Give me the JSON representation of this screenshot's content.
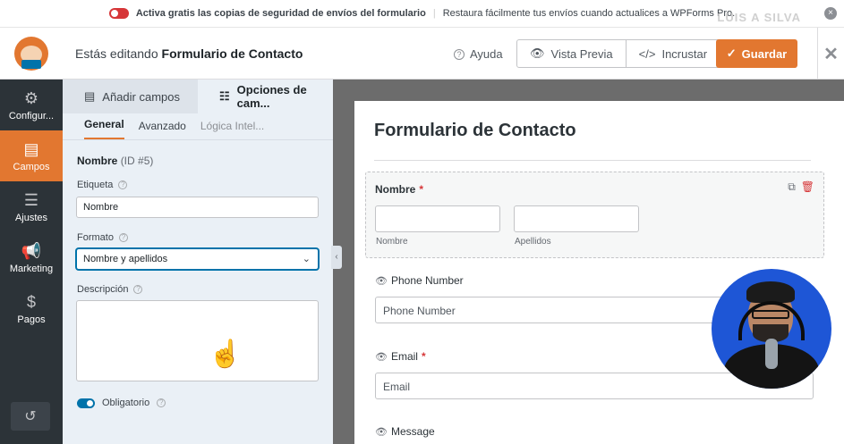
{
  "notice": {
    "strong_text": "Activa gratis las copias de seguridad de envíos del formulario",
    "text": "Restaura fácilmente tus envíos cuando actualices a WPForms Pro.",
    "close": "×",
    "watermark": "LUIS A SILVA"
  },
  "header": {
    "editing_prefix": "Estás editando",
    "form_name": "Formulario de Contacto",
    "help": "Ayuda",
    "preview": "Vista Previa",
    "embed": "Incrustar",
    "save": "Guardar",
    "close": "✕"
  },
  "nav": {
    "items": [
      {
        "label": "Configur...",
        "icon": "gear-icon",
        "glyph": "⚙"
      },
      {
        "label": "Campos",
        "icon": "fields-icon",
        "glyph": "▤"
      },
      {
        "label": "Ajustes",
        "icon": "sliders-icon",
        "glyph": "☰"
      },
      {
        "label": "Marketing",
        "icon": "megaphone-icon",
        "glyph": "📢"
      },
      {
        "label": "Pagos",
        "icon": "dollar-icon",
        "glyph": "$"
      }
    ],
    "history_glyph": "↺"
  },
  "panel": {
    "tabs": [
      "Añadir campos",
      "Opciones de cam..."
    ],
    "subtabs": [
      "General",
      "Avanzado",
      "Lógica Intel..."
    ],
    "field_name": "Nombre",
    "field_id": "(ID #5)",
    "label_label": "Etiqueta",
    "label_value": "Nombre",
    "format_label": "Formato",
    "format_value": "Nombre y apellidos",
    "description_label": "Descripción",
    "required_label": "Obligatorio"
  },
  "form": {
    "title": "Formulario de Contacto",
    "name_label": "Nombre",
    "first_sub": "Nombre",
    "last_sub": "Apellidos",
    "phone_label": "Phone Number",
    "phone_placeholder": "Phone Number",
    "email_label": "Email",
    "email_placeholder": "Email",
    "message_label": "Message",
    "required_mark": "*"
  },
  "colors": {
    "accent": "#e27730",
    "nav_bg": "#2c3338",
    "focus": "#0073aa",
    "danger": "#d63638"
  }
}
